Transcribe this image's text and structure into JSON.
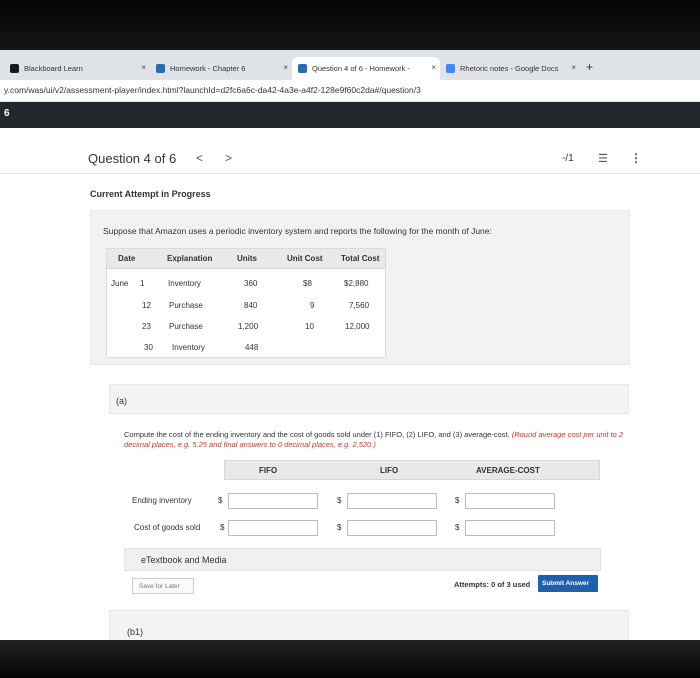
{
  "browser": {
    "tabs": [
      {
        "label": "Blackboard Learn",
        "icon": "blackboard-icon",
        "color": "#1a1a1a"
      },
      {
        "label": "Homework - Chapter 6",
        "icon": "wiley-icon",
        "color": "#2b6cb0"
      },
      {
        "label": "Question 4 of 6 - Homework -",
        "icon": "wiley-icon",
        "color": "#2b6cb0"
      },
      {
        "label": "Rhetoric notes - Google Docs",
        "icon": "docs-icon",
        "color": "#4285f4"
      }
    ],
    "close_glyph": "×",
    "new_tab_glyph": "+",
    "url": "y.com/was/ui/v2/assessment-player/index.html?launchId=d2fc6a6c-da42-4a3e-a4f2-128e9f60c2da#/question/3"
  },
  "strip": {
    "number": "6"
  },
  "question": {
    "title": "Question 4 of 6",
    "prev_glyph": "<",
    "next_glyph": ">",
    "score": "-/1",
    "list_glyph": "☰",
    "more_glyph": "⋮",
    "attempt_status": "Current Attempt in Progress"
  },
  "problem": {
    "statement": "Suppose that Amazon uses a periodic inventory system and reports the following for the month of June:",
    "headers": [
      "Date",
      "Explanation",
      "Units",
      "Unit Cost",
      "Total Cost"
    ],
    "rows": [
      {
        "month": "June",
        "day": "1",
        "explanation": "Inventory",
        "units": "360",
        "unit_cost": "$8",
        "total_cost": "$2,880"
      },
      {
        "month": "",
        "day": "12",
        "explanation": "Purchase",
        "units": "840",
        "unit_cost": "9",
        "total_cost": "7,560"
      },
      {
        "month": "",
        "day": "23",
        "explanation": "Purchase",
        "units": "1,200",
        "unit_cost": "10",
        "total_cost": "12,000"
      },
      {
        "month": "",
        "day": "30",
        "explanation": "Inventory",
        "units": "448",
        "unit_cost": "",
        "total_cost": ""
      }
    ]
  },
  "part_a": {
    "label": "(a)",
    "instruction": "Compute the cost of the ending inventory and the cost of goods sold under (1) FIFO, (2) LIFO, and (3) average-cost.",
    "instruction_note": "(Round average cost per unit to 2 decimal places, e.g. 5.25 and final answers to 0 decimal places, e.g. 2,520.)",
    "columns": [
      "FIFO",
      "LIFO",
      "AVERAGE-COST"
    ],
    "rows": [
      {
        "label": "Ending inventory",
        "values": [
          "",
          "",
          ""
        ]
      },
      {
        "label": "Cost of goods sold",
        "values": [
          "",
          "",
          ""
        ]
      }
    ],
    "currency": "$",
    "etextbook": "eTextbook and Media",
    "save_label": "Save for Later",
    "attempts": "Attempts: 0 of 3 used",
    "submit_label": "Submit Answer",
    "accent_color": "#1f5fae"
  },
  "part_b": {
    "label": "(b1)"
  }
}
